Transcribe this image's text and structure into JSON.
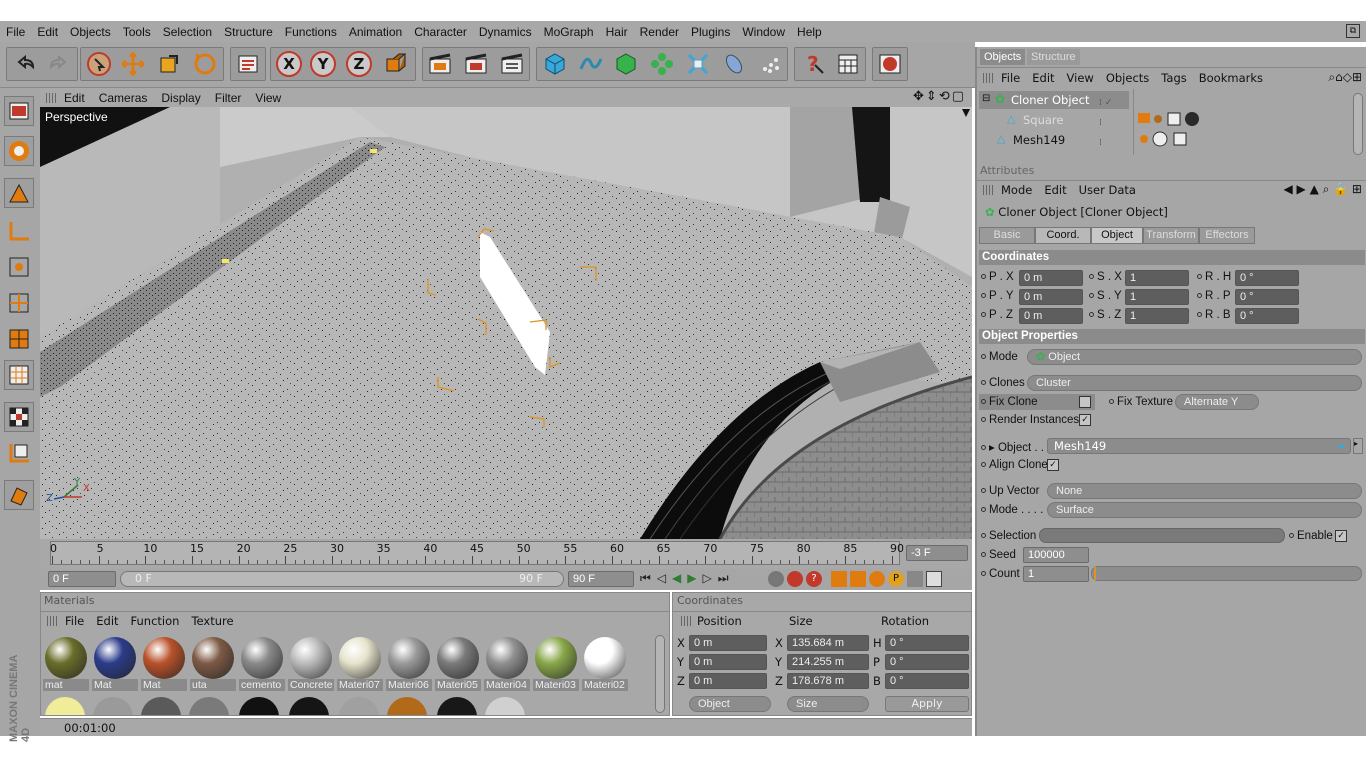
{
  "menu": [
    "File",
    "Edit",
    "Objects",
    "Tools",
    "Selection",
    "Structure",
    "Functions",
    "Animation",
    "Character",
    "Dynamics",
    "MoGraph",
    "Hair",
    "Render",
    "Plugins",
    "Window",
    "Help"
  ],
  "viewport": {
    "menu": [
      "Edit",
      "Cameras",
      "Display",
      "Filter",
      "View"
    ],
    "label": "Perspective"
  },
  "timeline": {
    "ticks": [
      "0",
      "5",
      "10",
      "15",
      "20",
      "25",
      "30",
      "35",
      "40",
      "45",
      "50",
      "55",
      "60",
      "65",
      "70",
      "75",
      "80",
      "85",
      "90"
    ],
    "current": "-3 F"
  },
  "transport": {
    "start": "0 F",
    "slider_start": "0 F",
    "slider_end": "90 F",
    "end": "90 F"
  },
  "materials": {
    "title": "Materials",
    "menu": [
      "File",
      "Edit",
      "Function",
      "Texture"
    ],
    "items": [
      {
        "label": "mat",
        "color": "#6a6d2a"
      },
      {
        "label": "Mat",
        "color": "#2b3c8a"
      },
      {
        "label": "Mat",
        "color": "#b8522a"
      },
      {
        "label": "uta",
        "color": "#7d5a45"
      },
      {
        "label": "cemento",
        "color": "#8a8a8a"
      },
      {
        "label": "Concrete",
        "color": "#bcbcbc"
      },
      {
        "label": "Materi07",
        "color": "#e7e4cc"
      },
      {
        "label": "Materi06",
        "color": "#9a9a9a"
      },
      {
        "label": "Materi05",
        "color": "#7a7a7a"
      },
      {
        "label": "Materi04",
        "color": "#909090"
      },
      {
        "label": "Materi03",
        "color": "#8aa84a"
      },
      {
        "label": "Materi02",
        "color": "#ffffff"
      }
    ]
  },
  "coordinates": {
    "title": "Coordinates",
    "headers": [
      "Position",
      "Size",
      "Rotation"
    ],
    "rows": [
      {
        "pl": "X",
        "pv": "0 m",
        "sl": "X",
        "sv": "135.684 m",
        "rl": "H",
        "rv": "0 °"
      },
      {
        "pl": "Y",
        "pv": "0 m",
        "sl": "Y",
        "sv": "214.255 m",
        "rl": "P",
        "rv": "0 °"
      },
      {
        "pl": "Z",
        "pv": "0 m",
        "sl": "Z",
        "sv": "178.678 m",
        "rl": "B",
        "rv": "0 °"
      }
    ],
    "mode1": "Object",
    "mode2": "Size",
    "apply": "Apply"
  },
  "status": {
    "time": "00:01:00"
  },
  "brand": "MAXON CINEMA 4D",
  "objects_panel": {
    "tabs": [
      "Objects",
      "Structure"
    ],
    "menu": [
      "File",
      "Edit",
      "View",
      "Objects",
      "Tags",
      "Bookmarks"
    ],
    "tree": [
      {
        "name": "Cloner Object",
        "indent": 0
      },
      {
        "name": "Square",
        "indent": 1
      },
      {
        "name": "Mesh149",
        "indent": 0
      }
    ]
  },
  "attributes": {
    "title": "Attributes",
    "menu": [
      "Mode",
      "Edit",
      "User Data"
    ],
    "object_name": "Cloner Object [Cloner Object]",
    "tabs": [
      "Basic",
      "Coord.",
      "Object",
      "Transform",
      "Effectors"
    ],
    "coord_header": "Coordinates",
    "coords": [
      {
        "a": "P . X",
        "av": "0 m",
        "b": "S . X",
        "bv": "1",
        "c": "R . H",
        "cv": "0 °"
      },
      {
        "a": "P . Y",
        "av": "0 m",
        "b": "S . Y",
        "bv": "1",
        "c": "R . P",
        "cv": "0 °"
      },
      {
        "a": "P . Z",
        "av": "0 m",
        "b": "S . Z",
        "bv": "1",
        "c": "R . B",
        "cv": "0 °"
      }
    ],
    "objprops_header": "Object Properties",
    "mode_label": "Mode",
    "mode_value": "Object",
    "clones_label": "Clones",
    "clones_value": "Cluster",
    "fixclone_label": "Fix Clone",
    "fixtexture_label": "Fix Texture",
    "fixtexture_value": "Alternate Y",
    "renderinst_label": "Render Instances",
    "object_label": "Object . .",
    "object_value": "Mesh149",
    "alignclone_label": "Align Clone",
    "upvector_label": "Up Vector",
    "upvector_value": "None",
    "mode2_label": "Mode . . . .",
    "mode2_value": "Surface",
    "selection_label": "Selection",
    "enable_label": "Enable",
    "seed_label": "Seed",
    "seed_value": "100000",
    "count_label": "Count",
    "count_value": "1"
  }
}
